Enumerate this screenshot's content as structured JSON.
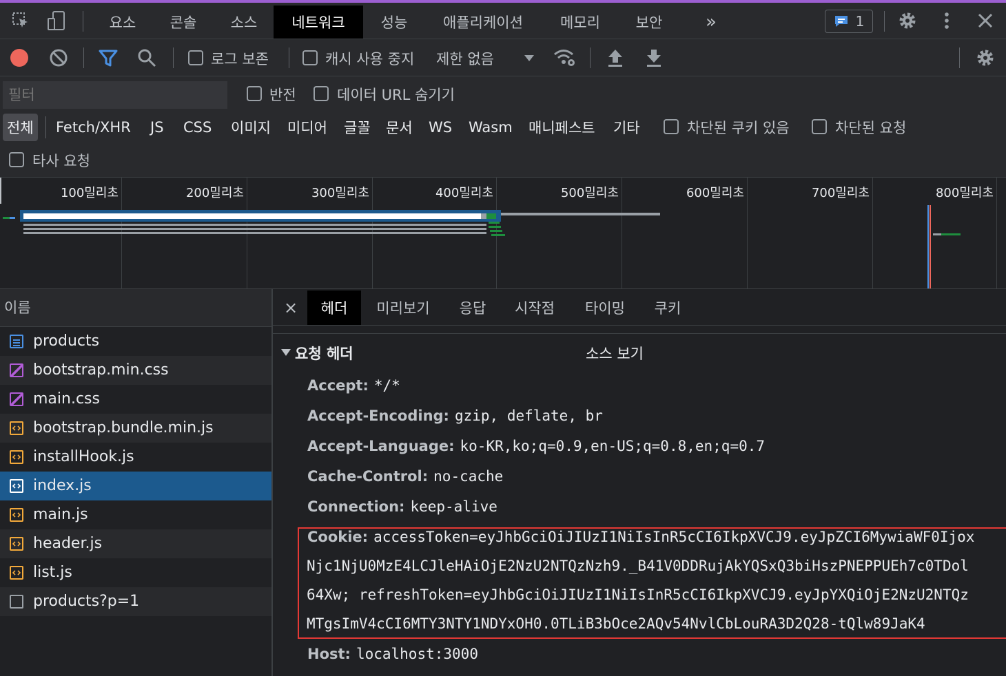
{
  "tabs": [
    "요소",
    "콘솔",
    "소스",
    "네트워크",
    "성능",
    "애플리케이션",
    "메모리",
    "보안"
  ],
  "issues_count": "1",
  "toolbar": {
    "preserve_log": "로그 보존",
    "disable_cache": "캐시 사용 중지",
    "throttle": "제한 없음"
  },
  "filter": {
    "placeholder": "필터",
    "invert": "반전",
    "hide_data_urls": "데이터 URL 숨기기",
    "types": [
      "전체",
      "Fetch/XHR",
      "JS",
      "CSS",
      "이미지",
      "미디어",
      "글꼴",
      "문서",
      "WS",
      "Wasm",
      "매니페스트",
      "기타"
    ],
    "blocked_cookies": "차단된 쿠키 있음",
    "blocked_requests": "차단된 요청",
    "third_party": "타사 요청"
  },
  "timeline": {
    "ticks": [
      "100밀리초",
      "200밀리초",
      "300밀리초",
      "400밀리초",
      "500밀리초",
      "600밀리초",
      "700밀리초",
      "800밀리초"
    ]
  },
  "requests": {
    "header": "이름",
    "items": [
      {
        "name": "products",
        "type": "doc"
      },
      {
        "name": "bootstrap.min.css",
        "type": "css"
      },
      {
        "name": "main.css",
        "type": "css"
      },
      {
        "name": "bootstrap.bundle.min.js",
        "type": "js"
      },
      {
        "name": "installHook.js",
        "type": "js"
      },
      {
        "name": "index.js",
        "type": "js",
        "selected": true
      },
      {
        "name": "main.js",
        "type": "js"
      },
      {
        "name": "header.js",
        "type": "js"
      },
      {
        "name": "list.js",
        "type": "js"
      },
      {
        "name": "products?p=1",
        "type": "other"
      }
    ]
  },
  "details": {
    "tabs": [
      "헤더",
      "미리보기",
      "응답",
      "시작점",
      "타이밍",
      "쿠키"
    ],
    "section_title": "요청 헤더",
    "view_source": "소스 보기",
    "headers": [
      {
        "name": "Accept:",
        "value": "*/*"
      },
      {
        "name": "Accept-Encoding:",
        "value": "gzip, deflate, br"
      },
      {
        "name": "Accept-Language:",
        "value": "ko-KR,ko;q=0.9,en-US;q=0.8,en;q=0.7"
      },
      {
        "name": "Cache-Control:",
        "value": "no-cache"
      },
      {
        "name": "Connection:",
        "value": "keep-alive"
      }
    ],
    "cookie": {
      "name": "Cookie:",
      "line1": "accessToken=eyJhbGciOiJIUzI1NiIsInR5cCI6IkpXVCJ9.eyJpZCI6MywiaWF0Ijox",
      "line2": "Njc1NjU0MzE4LCJleHAiOjE2NzU2NTQzNzh9._B41V0DDRujAkYQSxQ3biHszPNEPPUEh7c0TDol",
      "line3": "64Xw; refreshToken=eyJhbGciOiJIUzI1NiIsInR5cCI6IkpXVCJ9.eyJpYXQiOjE2NzU2NTQz",
      "line4": "MTgsImV4cCI6MTY3NTY1NDYxOH0.0TLiB3bOce2AQv54NvlCbLouRA3D2Q28-tQlw89JaK4"
    },
    "host": {
      "name": "Host:",
      "value": "localhost:3000"
    }
  },
  "colors": {
    "accent": "#1c5a8e",
    "record": "#ee675c",
    "highlight_box": "#e53935"
  }
}
